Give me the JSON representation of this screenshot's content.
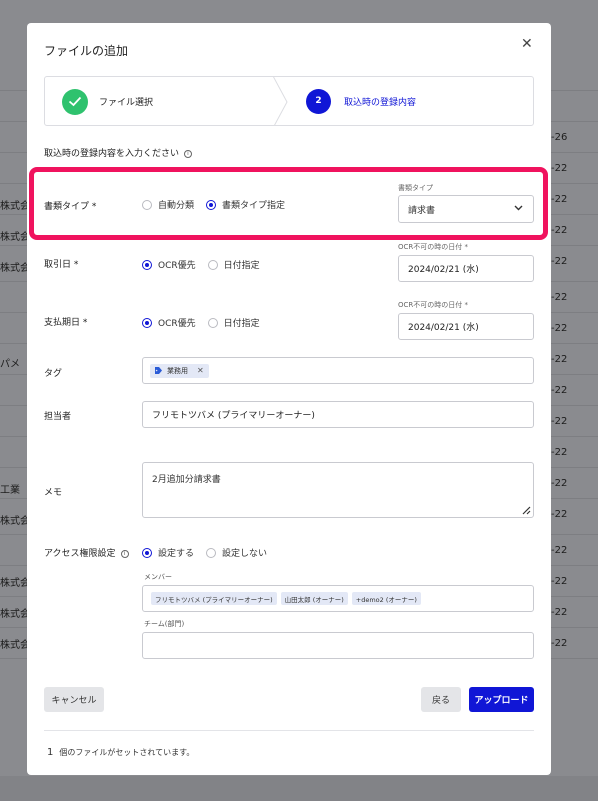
{
  "background": {
    "left_fragments": [
      "株式会",
      "株式会",
      "株式会",
      "パメ",
      "工業",
      "株式会",
      "株式会",
      "株式会",
      "株式会"
    ],
    "right_fragments": [
      "-26",
      "-22",
      "-22",
      "-22",
      "-22",
      "-22",
      "-22",
      "-22",
      "-22",
      "-22",
      "-22",
      "-22",
      "-22",
      "-22",
      "-22",
      "-22",
      "-22"
    ]
  },
  "modal": {
    "title": "ファイルの追加",
    "close_icon": "close-icon"
  },
  "stepper": {
    "step1_label": "ファイル選択",
    "step1_status": "completed",
    "step2_number": "2",
    "step2_label": "取込時の登録内容"
  },
  "form": {
    "subtitle": "取込時の登録内容を入力ください",
    "doc_type": {
      "label": "書類タイプ *",
      "option_auto": "自動分類",
      "option_manual": "書類タイプ指定",
      "selected": "manual",
      "caption": "書類タイプ",
      "value": "請求書"
    },
    "transaction_date": {
      "label": "取引日 *",
      "option_ocr": "OCR優先",
      "option_date": "日付指定",
      "selected": "ocr",
      "caption": "OCR不可の時の日付 *",
      "value": "2024/02/21 (水)"
    },
    "due_date": {
      "label": "支払期日 *",
      "option_ocr": "OCR優先",
      "option_date": "日付指定",
      "selected": "ocr",
      "caption": "OCR不可の時の日付 *",
      "value": "2024/02/21 (水)"
    },
    "tag": {
      "label": "タグ",
      "chips": [
        "業務用"
      ]
    },
    "assignee": {
      "label": "担当者",
      "value": "フリモトツバメ (プライマリーオーナー)"
    },
    "memo": {
      "label": "メモ",
      "value": "2月追加分請求書"
    },
    "access": {
      "label": "アクセス権限設定",
      "option_set": "設定する",
      "option_unset": "設定しない",
      "selected": "set",
      "members_caption": "メンバー",
      "members": [
        "フリモトツバメ (プライマリーオーナー)",
        "山田太郎 (オーナー)",
        "+demo2 (オーナー)"
      ],
      "team_caption": "チーム(部門)",
      "team_value": ""
    }
  },
  "buttons": {
    "cancel": "キャンセル",
    "back": "戻る",
    "upload": "アップロード"
  },
  "footer": {
    "count": "1",
    "text": "個のファイルがセットされています。"
  },
  "colors": {
    "primary": "#1016d6",
    "success": "#2fc26e",
    "highlight": "#f0135e"
  }
}
